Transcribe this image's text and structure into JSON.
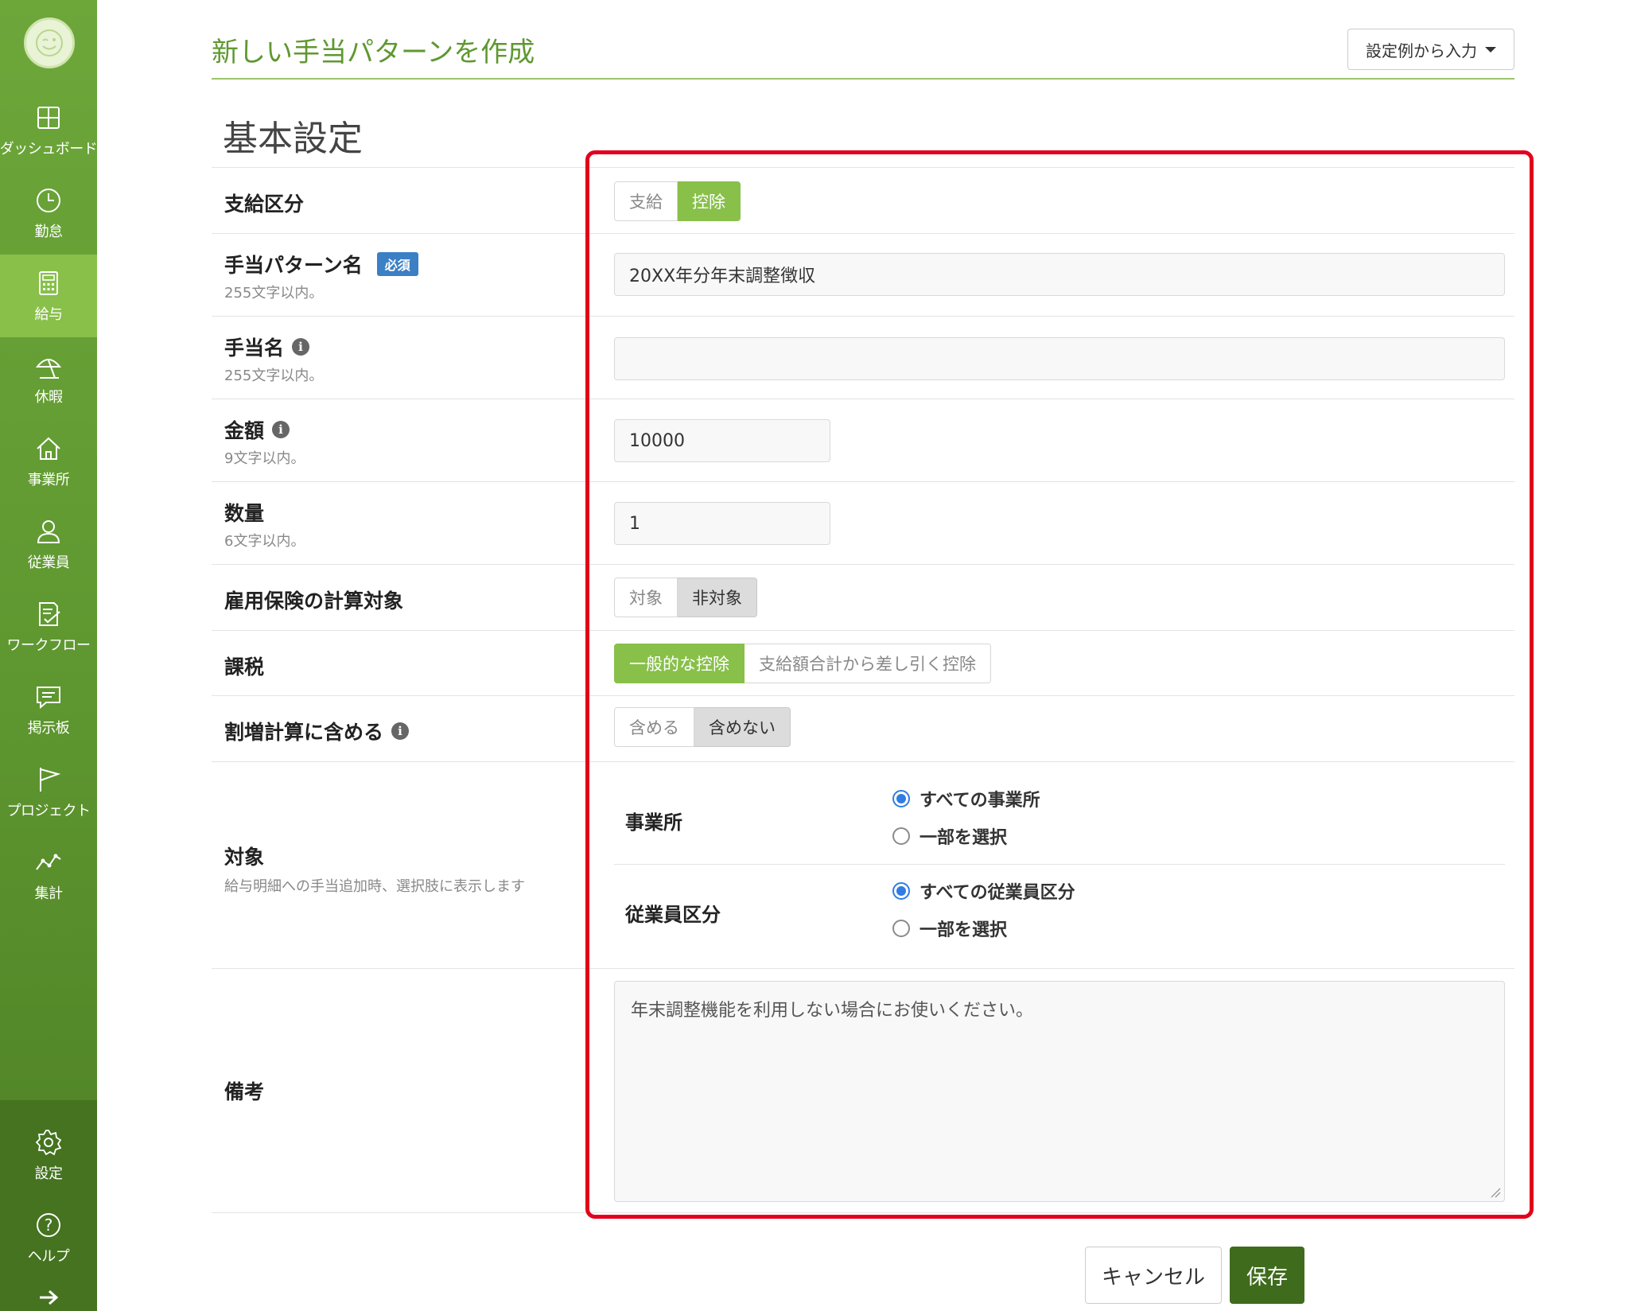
{
  "sidebar": {
    "avatar_icon": "smiley-icon",
    "items": [
      {
        "label": "ダッシュボード",
        "icon": "dashboard-icon"
      },
      {
        "label": "勤怠",
        "icon": "clock-icon"
      },
      {
        "label": "給与",
        "icon": "calculator-icon"
      },
      {
        "label": "休暇",
        "icon": "parasol-icon"
      },
      {
        "label": "事業所",
        "icon": "home-icon"
      },
      {
        "label": "従業員",
        "icon": "person-icon"
      },
      {
        "label": "ワークフロー",
        "icon": "checklist-icon"
      },
      {
        "label": "掲示板",
        "icon": "chat-icon"
      },
      {
        "label": "プロジェクト",
        "icon": "flag-icon"
      },
      {
        "label": "集計",
        "icon": "line-chart-icon"
      }
    ],
    "bottom_items": [
      {
        "label": "設定",
        "icon": "gear-icon"
      },
      {
        "label": "ヘルプ",
        "icon": "help-icon"
      }
    ],
    "collapse_icon": "arrow-right-icon",
    "colors": {
      "background": "#5f9830",
      "active": "#88c04a"
    }
  },
  "header": {
    "title": "新しい手当パターンを作成",
    "examples_button": "設定例から入力"
  },
  "section_title": "基本設定",
  "form": {
    "payment_type": {
      "label": "支給区分",
      "options": [
        "支給",
        "控除"
      ],
      "selected": "控除"
    },
    "pattern_name": {
      "label": "手当パターン名",
      "badge": "必須",
      "hint": "255文字以内。",
      "value": "20XX年分年末調整徴収"
    },
    "allowance_name": {
      "label": "手当名",
      "hint": "255文字以内。",
      "value": ""
    },
    "amount": {
      "label": "金額",
      "hint": "9文字以内。",
      "value": "10000"
    },
    "quantity": {
      "label": "数量",
      "hint": "6文字以内。",
      "value": "1"
    },
    "employment_insurance": {
      "label": "雇用保険の計算対象",
      "options": [
        "対象",
        "非対象"
      ],
      "selected": "非対象"
    },
    "taxation": {
      "label": "課税",
      "options": [
        "一般的な控除",
        "支給額合計から差し引く控除"
      ],
      "selected": "一般的な控除"
    },
    "overtime": {
      "label": "割増計算に含める",
      "options": [
        "含める",
        "含めない"
      ],
      "selected": "含めない"
    },
    "target": {
      "label": "対象",
      "hint": "給与明細への手当追加時、選択肢に表示します",
      "office": {
        "label": "事業所",
        "options": [
          "すべての事業所",
          "一部を選択"
        ],
        "selected": "すべての事業所"
      },
      "employee_class": {
        "label": "従業員区分",
        "options": [
          "すべての従業員区分",
          "一部を選択"
        ],
        "selected": "すべての従業員区分"
      }
    },
    "notes": {
      "label": "備考",
      "value": "年末調整機能を利用しない場合にお使いください。"
    }
  },
  "actions": {
    "cancel": "キャンセル",
    "save": "保存"
  },
  "colors": {
    "accent": "#88c04a",
    "title": "#5f9830",
    "save": "#3f6b1d",
    "radio": "#2f7de1",
    "highlight": "#e3001b"
  }
}
